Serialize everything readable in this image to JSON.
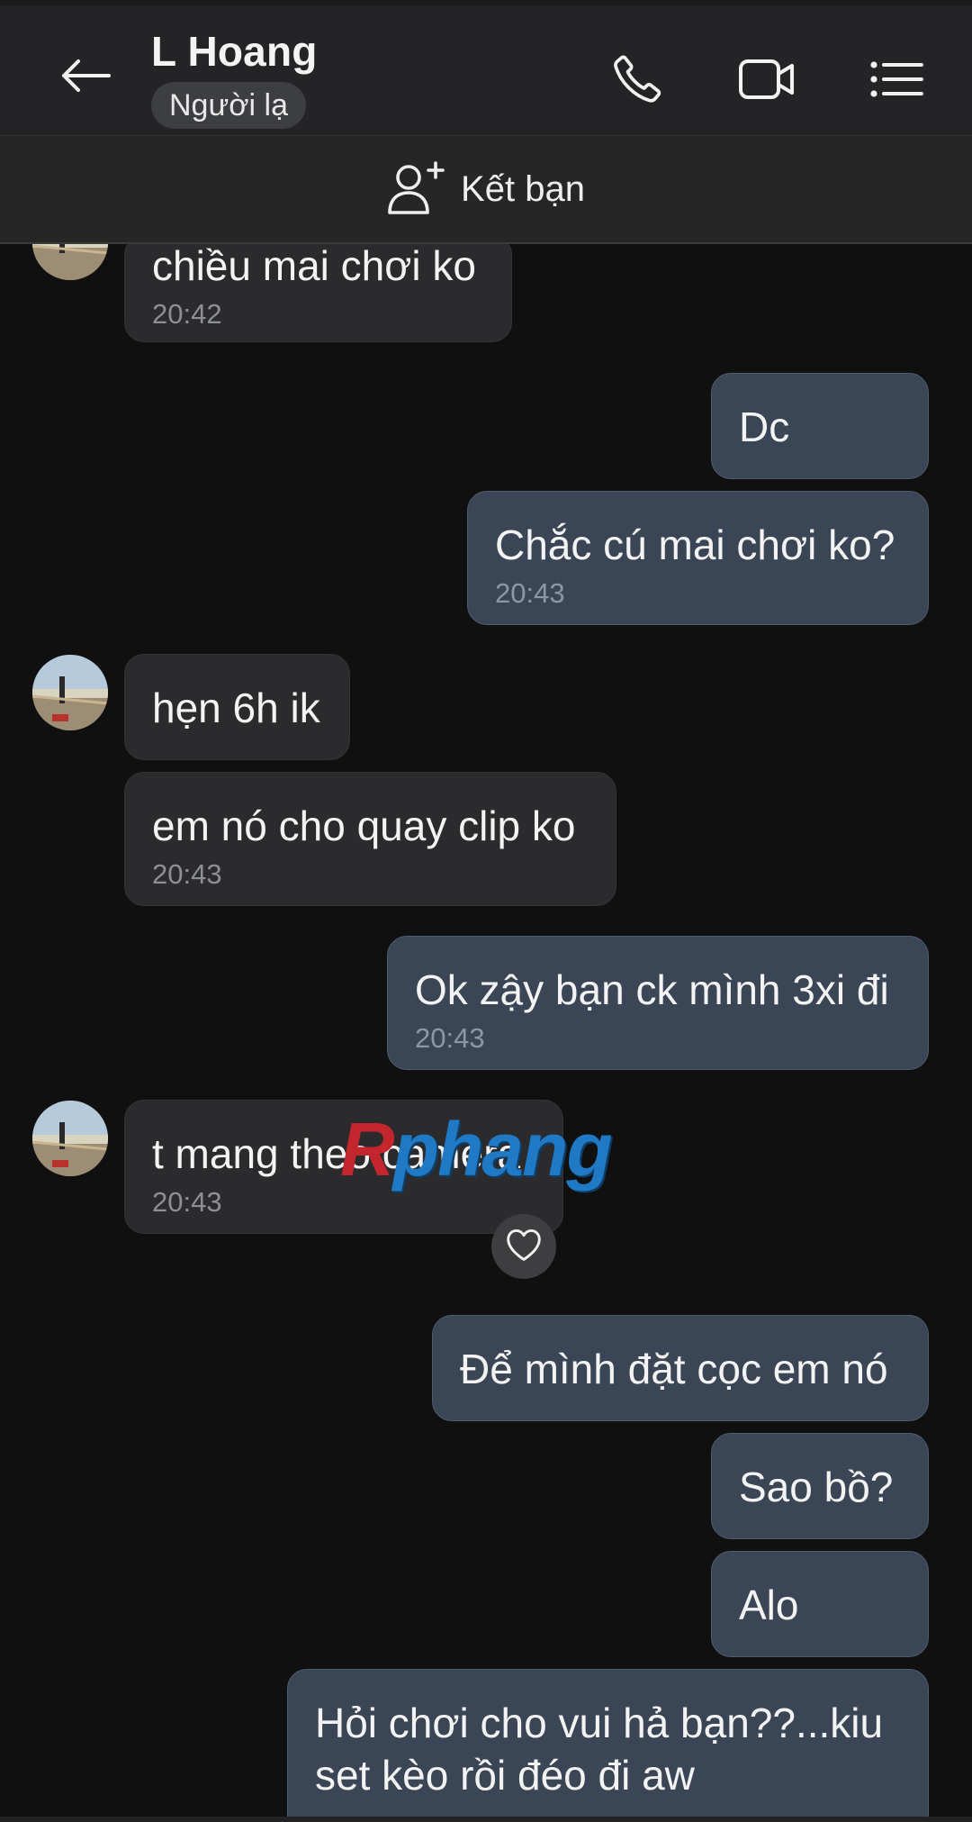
{
  "header": {
    "title": "L Hoang",
    "badge": "Người lạ",
    "icons": [
      "back-arrow-icon",
      "phone-icon",
      "video-camera-icon",
      "menu-list-icon"
    ]
  },
  "friend_bar": {
    "label": "Kết bạn",
    "icon": "add-person-icon"
  },
  "messages": [
    {
      "side": "in",
      "text": "chiều mai chơi ko",
      "time": "20:42"
    },
    {
      "side": "out",
      "text": "Dc",
      "time": ""
    },
    {
      "side": "out",
      "text": "Chắc cú mai chơi ko?",
      "time": "20:43"
    },
    {
      "side": "in",
      "text": "hẹn 6h ik",
      "time": ""
    },
    {
      "side": "in",
      "text": "em nó cho quay clip ko",
      "time": "20:43"
    },
    {
      "side": "out",
      "text": "Ok zậy bạn ck mình 3xi đi",
      "time": "20:43"
    },
    {
      "side": "in",
      "text": "t mang theo camera",
      "time": "20:43"
    },
    {
      "side": "out",
      "text": "Để mình đặt cọc em nó",
      "time": ""
    },
    {
      "side": "out",
      "text": "Sao bồ?",
      "time": ""
    },
    {
      "side": "out",
      "text": "Alo",
      "time": ""
    },
    {
      "side": "out",
      "text_line1": "Hỏi chơi cho vui hả bạn??...kiu",
      "text_line2": "set kèo rồi đéo đi aw",
      "time": ""
    }
  ],
  "reaction": {
    "icon": "heart-icon"
  },
  "watermark": {
    "first": "R",
    "rest": "phang"
  },
  "colors": {
    "background": "#101011",
    "incoming_bubble": "#2b2b2d",
    "outgoing_bubble": "#3a4656",
    "header": "#242426"
  }
}
